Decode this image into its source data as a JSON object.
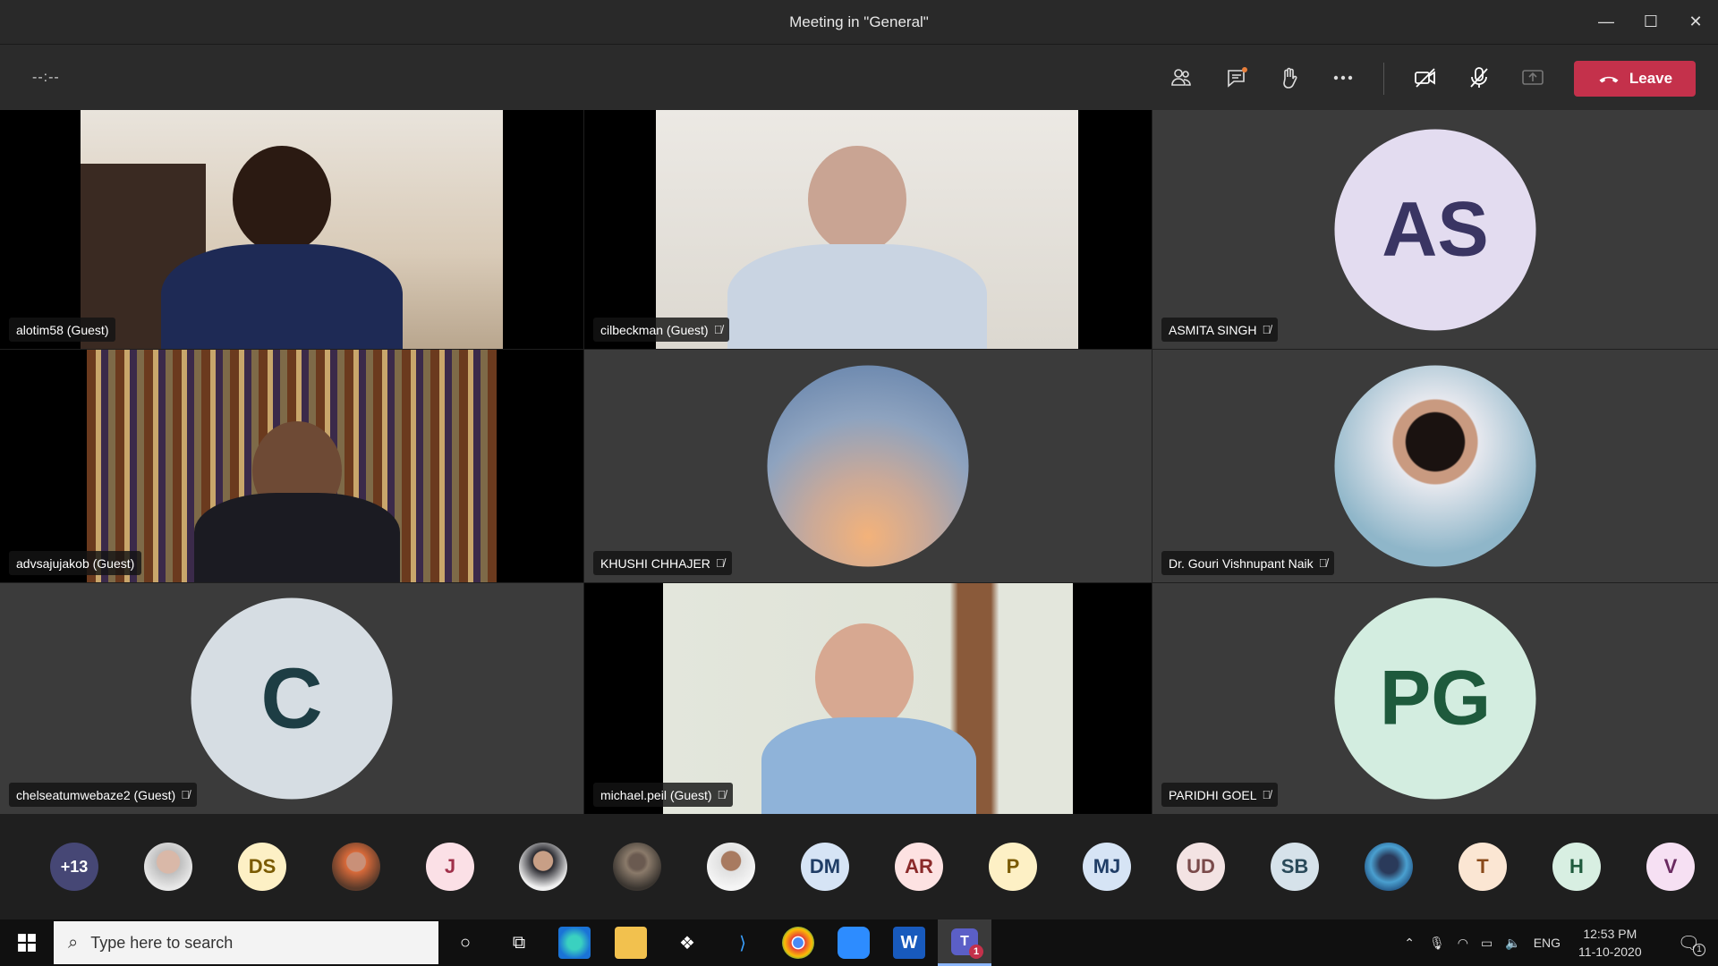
{
  "window": {
    "title": "Meeting in \"General\"",
    "controls": [
      "—",
      "☐",
      "✕"
    ]
  },
  "toolbar": {
    "timer": "--:--",
    "leave_label": "Leave"
  },
  "tiles": [
    {
      "name": "alotim58 (Guest)",
      "kind": "video",
      "muted": false
    },
    {
      "name": "cilbeckman (Guest)",
      "kind": "video",
      "muted": true
    },
    {
      "name": "ASMITA SINGH",
      "kind": "avatar",
      "initials": "AS",
      "muted": true
    },
    {
      "name": "advsajujakob (Guest)",
      "kind": "video",
      "muted": false
    },
    {
      "name": "KHUSHI CHHAJER",
      "kind": "photo",
      "muted": true
    },
    {
      "name": "Dr. Gouri Vishnupant Naik",
      "kind": "photo",
      "muted": true
    },
    {
      "name": "chelseatumwebaze2 (Guest)",
      "kind": "avatar",
      "initials": "C",
      "muted": true
    },
    {
      "name": "michael.peil (Guest)",
      "kind": "video",
      "muted": true
    },
    {
      "name": "PARIDHI GOEL",
      "kind": "avatar",
      "initials": "PG",
      "muted": true
    }
  ],
  "strip": [
    "+13",
    "",
    "DS",
    "",
    "J",
    "",
    "",
    "",
    "DM",
    "AR",
    "P",
    "MJ",
    "UD",
    "SB",
    "",
    "T",
    "H",
    "V"
  ],
  "taskbar": {
    "search_placeholder": "Type here to search",
    "language": "ENG",
    "time": "12:53 PM",
    "date": "11-10-2020",
    "teams_badge": "1",
    "notif_badge": "1"
  }
}
